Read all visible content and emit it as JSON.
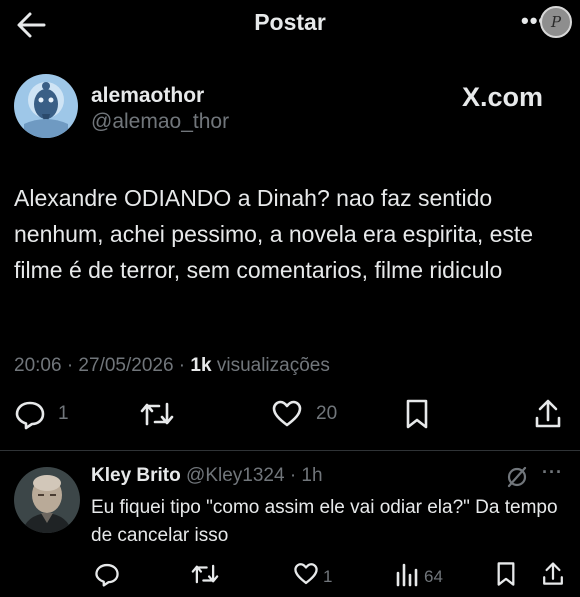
{
  "header": {
    "title": "Postar",
    "more_label": "•••",
    "watermark": "P"
  },
  "tweet": {
    "display_name": "alemaothor",
    "handle": "@alemao_thor",
    "source_badge": "X.com",
    "text": "Alexandre ODIANDO a Dinah?  nao faz sentido nenhum, achei pessimo, a novela era espirita, este filme é de terror, sem comentarios, filme ridiculo",
    "time": "20:06 · 27/05/2026 ·",
    "views_count": "1k",
    "views_label": "visualizações",
    "replies": "1",
    "likes": "20"
  },
  "reply": {
    "display_name": "Kley Brito",
    "handle_time": "@Kley1324 · 1h",
    "text": "Eu fiquei tipo \"como assim ele vai odiar ela?\" Da tempo de cancelar isso",
    "likes": "1",
    "views": "64",
    "more_label": "···"
  },
  "colors": {
    "background": "#000000",
    "text_primary": "#e7e9ea",
    "text_secondary": "#71767b",
    "divider": "#2f3336"
  },
  "icons": [
    "back-arrow-icon",
    "more-icon",
    "reply-icon",
    "retweet-icon",
    "like-icon",
    "bookmark-icon",
    "share-icon",
    "grok-icon",
    "views-icon"
  ]
}
